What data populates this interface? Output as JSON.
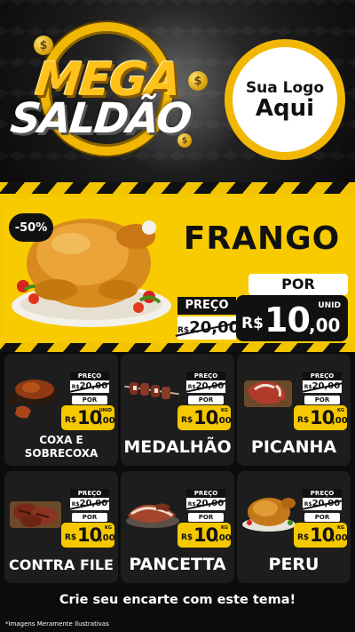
{
  "header": {
    "title_line1": "MEGA",
    "title_line2": "SALDÃO",
    "logo_line1": "Sua Logo",
    "logo_line2": "Aqui",
    "coin_symbol": "$"
  },
  "featured": {
    "discount": "-50%",
    "name": "FRANGO",
    "por": "POR",
    "preco_label": "PREÇO",
    "old_currency": "R$",
    "old_price": "20,00",
    "currency": "R$",
    "price_int": "10",
    "price_dec": ",00",
    "unit": "UNID"
  },
  "products": [
    {
      "name_lines": [
        "COXA E",
        "SOBRECOXA"
      ],
      "preco_label": "PREÇO",
      "old_currency": "R$",
      "old_price": "20,00",
      "por": "POR",
      "currency": "R$",
      "price_int": "10",
      "price_dec": ",00",
      "unit": "UNID",
      "icon": "chicken-leg-icon"
    },
    {
      "name": "MEDALHÃO",
      "preco_label": "PREÇO",
      "old_currency": "R$",
      "old_price": "20,00",
      "por": "POR",
      "currency": "R$",
      "price_int": "10",
      "price_dec": ",00",
      "unit": "KG",
      "icon": "skewer-icon"
    },
    {
      "name": "PICANHA",
      "preco_label": "PREÇO",
      "old_currency": "R$",
      "old_price": "20,00",
      "por": "POR",
      "currency": "R$",
      "price_int": "10",
      "price_dec": ",00",
      "unit": "KG",
      "icon": "steak-icon"
    },
    {
      "name": "CONTRA FILE",
      "preco_label": "PREÇO",
      "old_currency": "R$",
      "old_price": "20,00",
      "por": "POR",
      "currency": "R$",
      "price_int": "10",
      "price_dec": ",00",
      "unit": "KG",
      "icon": "steak-cuts-icon"
    },
    {
      "name": "PANCETTA",
      "preco_label": "PREÇO",
      "old_currency": "R$",
      "old_price": "20,00",
      "por": "POR",
      "currency": "R$",
      "price_int": "10",
      "price_dec": ",00",
      "unit": "KG",
      "icon": "pancetta-icon"
    },
    {
      "name": "PERU",
      "preco_label": "PREÇO",
      "old_currency": "R$",
      "old_price": "20,00",
      "por": "POR",
      "currency": "R$",
      "price_int": "10",
      "price_dec": ",00",
      "unit": "KG",
      "icon": "roast-turkey-icon"
    }
  ],
  "footer": {
    "cta": "Crie seu encarte com este tema!",
    "disclaimer": "*Imagens Meramente Ilustrativas"
  },
  "colors": {
    "yellow": "#f5c800",
    "dark": "#111111",
    "card": "#1d1d1d"
  }
}
